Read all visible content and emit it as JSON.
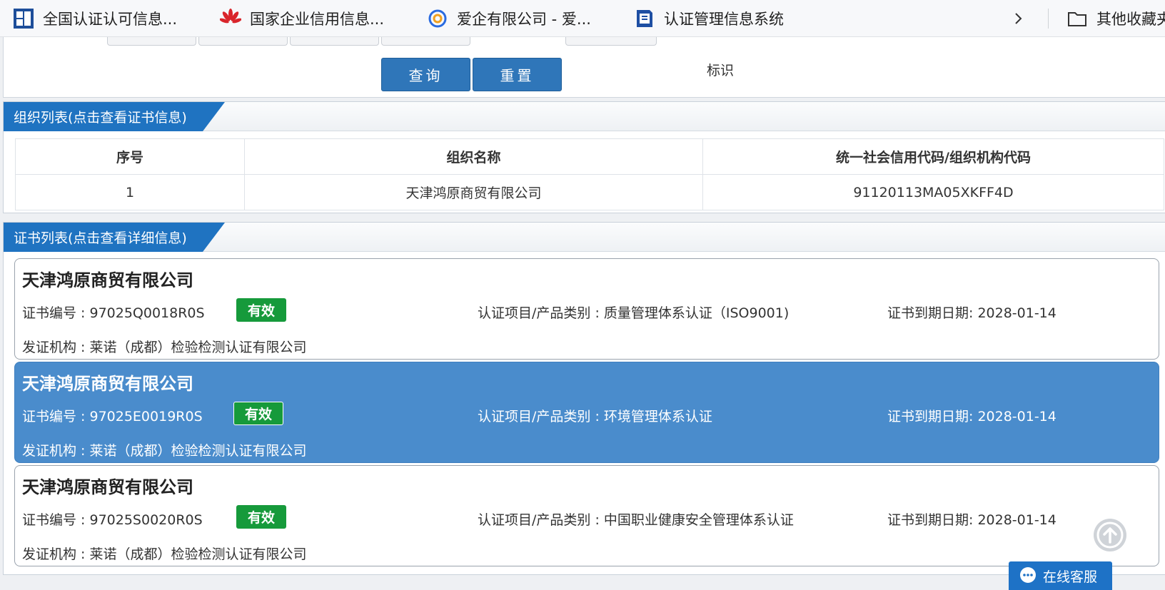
{
  "bookmarks": [
    {
      "label": "全国认证认可信息...",
      "icon": "cnca-icon"
    },
    {
      "label": "国家企业信用信息...",
      "icon": "huawei-like-icon"
    },
    {
      "label": "爱企有限公司 - 爱...",
      "icon": "aiqi-icon"
    },
    {
      "label": "认证管理信息系统",
      "icon": "cert-system-icon"
    }
  ],
  "other_bookmarks": "其他收藏夹",
  "search": {
    "query_label": "查询",
    "reset_label": "重置",
    "tag_label": "标识"
  },
  "org_section": {
    "title": "组织列表(点击查看证书信息)",
    "headers": [
      "序号",
      "组织名称",
      "统一社会信用代码/组织机构代码"
    ],
    "rows": [
      {
        "no": "1",
        "name": "天津鸿原商贸有限公司",
        "code": "91120113MA05XKFF4D"
      }
    ]
  },
  "cert_section": {
    "title": "证书列表(点击查看详细信息)",
    "cards": [
      {
        "org": "天津鸿原商贸有限公司",
        "cert_no": "证书编号 : 97025Q0018R0S",
        "status": "有效",
        "category": "认证项目/产品类别 : 质量管理体系认证（ISO9001)",
        "expiry": "证书到期日期: 2028-01-14",
        "issuer": "发证机构 : 莱诺（成都）检验检测认证有限公司"
      },
      {
        "org": "天津鸿原商贸有限公司",
        "cert_no": "证书编号 : 97025E0019R0S",
        "status": "有效",
        "category": "认证项目/产品类别 : 环境管理体系认证",
        "expiry": "证书到期日期: 2028-01-14",
        "issuer": "发证机构 : 莱诺（成都）检验检测认证有限公司"
      },
      {
        "org": "天津鸿原商贸有限公司",
        "cert_no": "证书编号 : 97025S0020R0S",
        "status": "有效",
        "category": "认证项目/产品类别 : 中国职业健康安全管理体系认证",
        "expiry": "证书到期日期: 2028-01-14",
        "issuer": "发证机构 : 莱诺（成都）检验检测认证有限公司"
      }
    ]
  },
  "online_service": "在线客服",
  "colors": {
    "primary": "#1f73c1",
    "selected_card": "#4a8ccc",
    "valid_badge": "#169a3b"
  }
}
